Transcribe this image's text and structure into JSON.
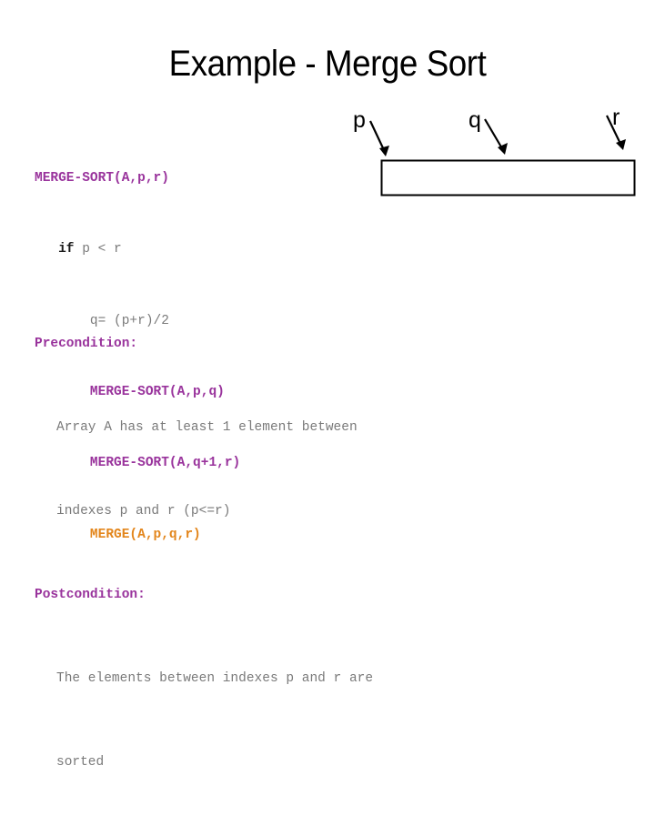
{
  "slide": {
    "title": "Example - Merge Sort",
    "background_color": "#ffffff"
  },
  "colors": {
    "procedure_purple": "#99339c",
    "merge_orange": "#e3861c",
    "keyword_black": "#1a1a1a",
    "body_gray": "#7a7a7a",
    "title_black": "#000000",
    "diagram_stroke": "#000000"
  },
  "pseudocode": {
    "lines": [
      {
        "indent": 0,
        "segments": [
          {
            "text": "MERGE-SORT(A,p,r)",
            "style": "procedure"
          }
        ]
      },
      {
        "indent": 1,
        "segments": [
          {
            "text": "if ",
            "style": "keyword"
          },
          {
            "text": "p < r",
            "style": "plain"
          }
        ]
      },
      {
        "indent": 2,
        "segments": [
          {
            "text": "q= (p+r)/2",
            "style": "plain"
          }
        ]
      },
      {
        "indent": 2,
        "segments": [
          {
            "text": "MERGE-SORT(A,p,q)",
            "style": "procedure"
          }
        ]
      },
      {
        "indent": 2,
        "segments": [
          {
            "text": "MERGE-SORT(A,q+1,r)",
            "style": "procedure"
          }
        ]
      },
      {
        "indent": 2,
        "segments": [
          {
            "text": "MERGE(A,p,q,r)",
            "style": "merge"
          }
        ]
      }
    ],
    "line_0_text": "MERGE-SORT(A,p,r)",
    "line_1_keyword": "if ",
    "line_1_plain": "p < r",
    "line_2_text": "q= (p+r)/2",
    "line_3_text": "MERGE-SORT(A,p,q)",
    "line_4_text": "MERGE-SORT(A,q+1,r)",
    "line_5_text": "MERGE(A,p,q,r)"
  },
  "conditions": {
    "precondition_label": "Precondition:",
    "precondition_body_line1": "Array A has at least 1 element between",
    "precondition_body_line2": "indexes p and r (p<=r)",
    "postcondition_label": "Postcondition:",
    "postcondition_body_line1": "The elements between indexes p and r are",
    "postcondition_body_line2": "sorted"
  },
  "diagram": {
    "description": "array-range-rectangle-with-index-markers",
    "markers": [
      {
        "name": "p",
        "label": "p"
      },
      {
        "name": "q",
        "label": "q"
      },
      {
        "name": "r",
        "label": "r"
      }
    ],
    "marker_p_label": "p",
    "marker_q_label": "q",
    "marker_r_label": "r"
  }
}
